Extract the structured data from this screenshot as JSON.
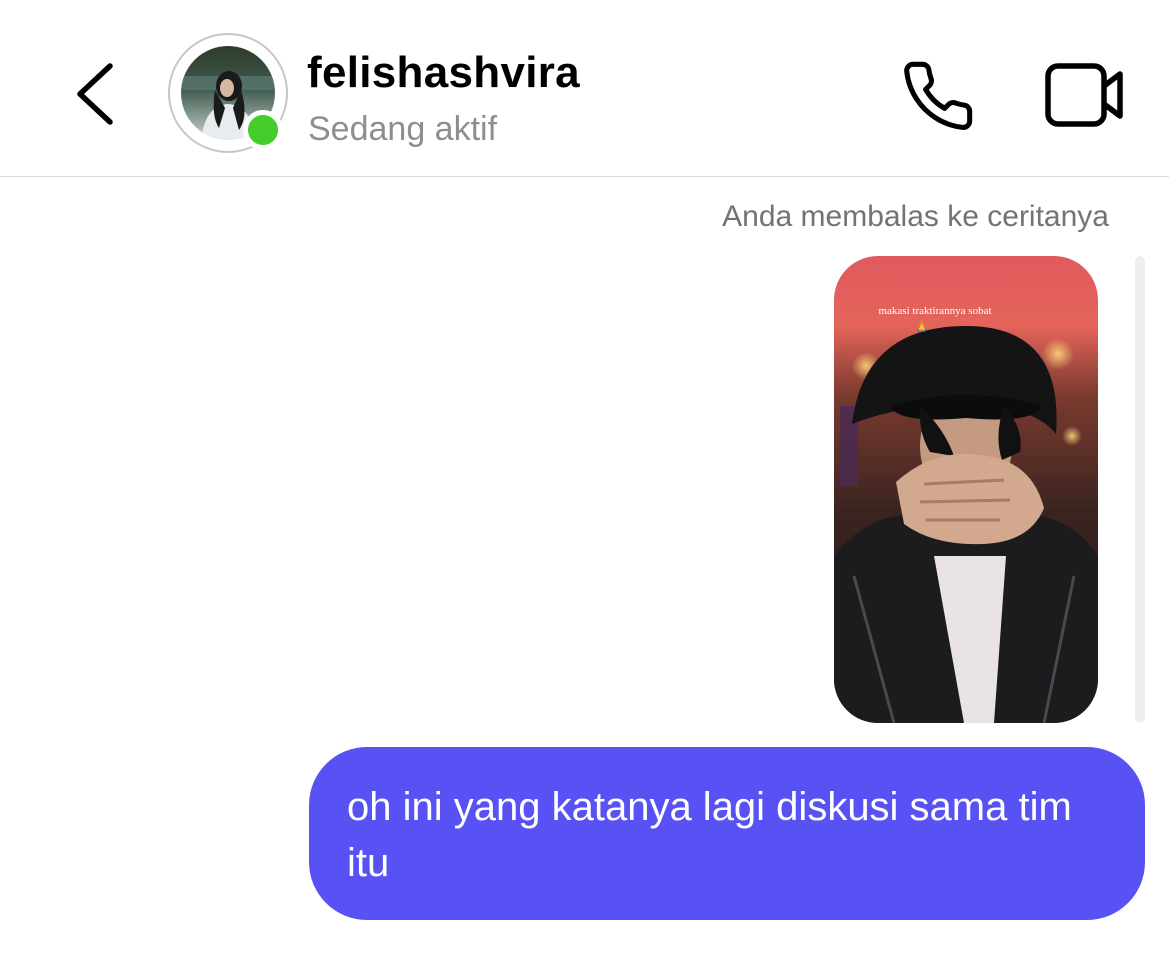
{
  "header": {
    "username": "felishashvira",
    "status": "Sedang aktif",
    "online_indicator_color": "#44cc2a",
    "icons": {
      "back": "chevron-left-icon",
      "call": "phone-icon",
      "video": "video-camera-icon"
    }
  },
  "thread": {
    "reply_note": "Anda membalas ke ceritanya",
    "story_caption": "makasi traktirannya sobat",
    "message": {
      "text": "oh ini yang katanya lagi diskusi sama tim itu",
      "bubble_color": "#5851f3"
    }
  }
}
